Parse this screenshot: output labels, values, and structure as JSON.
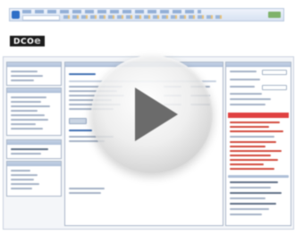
{
  "brand": {
    "text": "DCO",
    "mark": "e"
  },
  "icons": {
    "play": "play-icon",
    "app": "app-logo-icon"
  },
  "colors": {
    "accent_red": "#e04141",
    "toolbar_blue": "#2e6fc7",
    "play_triangle": "#6b6b6b"
  }
}
